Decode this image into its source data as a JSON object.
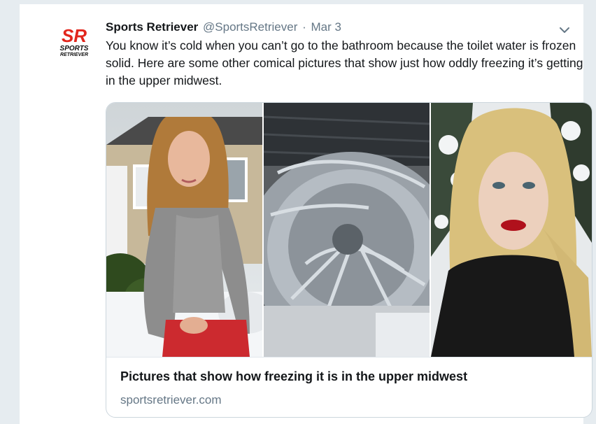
{
  "tweet": {
    "author_name": "Sports Retriever",
    "handle": "@SportsRetriever",
    "separator": "·",
    "date": "Mar 3",
    "text": "You know it’s cold when you can’t go to the bathroom because the toilet water is frozen solid. Here are some other comical pictures that show just how oddly freezing it’s getting in the upper midwest.",
    "avatar": {
      "logo_letters": "SR",
      "logo_word_1": "SPORTS",
      "logo_word_2": "RETRIEVER",
      "brand_color": "#e2261c"
    },
    "more_icon": "chevron-down-icon"
  },
  "card": {
    "title": "Pictures that show how freezing it is in the upper midwest",
    "domain": "sportsretriever.com",
    "images": [
      {
        "name": "woman-gray-top-snow-photo"
      },
      {
        "name": "frozen-tire-ice-photo"
      },
      {
        "name": "blonde-woman-red-lips-photo"
      }
    ]
  },
  "colors": {
    "background": "#e6ecf0",
    "text_primary": "#14171a",
    "text_secondary": "#657786",
    "border": "#ccd6dd"
  }
}
